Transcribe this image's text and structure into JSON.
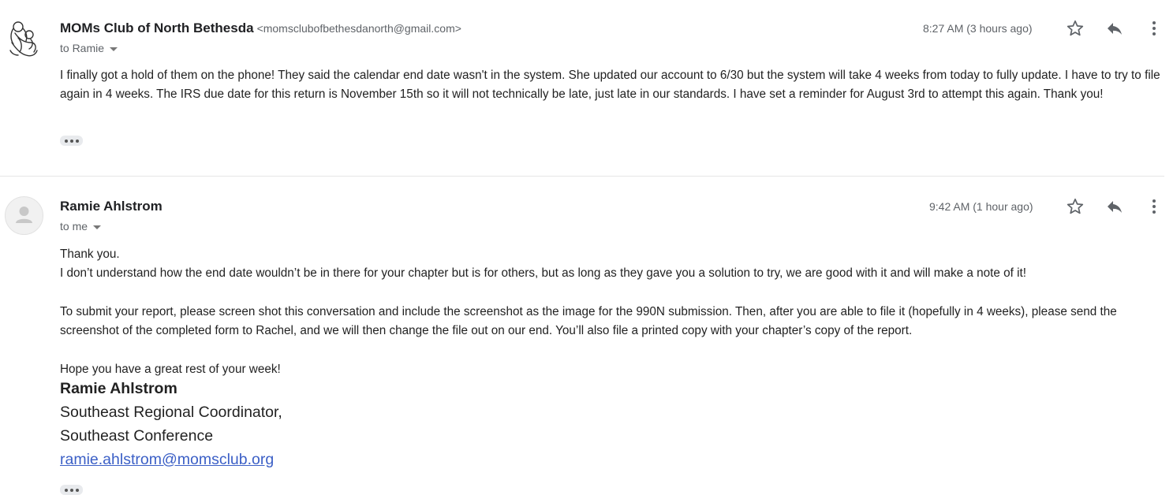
{
  "messages": [
    {
      "sender_name": "MOMs Club of North Bethesda",
      "sender_email": "<momsclubofbethesdanorth@gmail.com>",
      "to": "to Ramie",
      "timestamp": "8:27 AM (3 hours ago)",
      "avatar_icon": "club-logo-icon",
      "body": [
        "I finally got a hold of them on the phone! They said the calendar end date wasn't in the system. She updated our account to 6/30 but the system will take 4 weeks from today to fully update. I have to try to file again in 4 weeks. The IRS due date for this return is November 15th so it will not technically be late, just late in our standards. I have set a reminder for August 3rd to attempt this again. Thank you!"
      ]
    },
    {
      "sender_name": "Ramie Ahlstrom",
      "to": "to me",
      "timestamp": "9:42 AM (1 hour ago)",
      "avatar_icon": "default-person-icon",
      "body": [
        "Thank you.",
        "I don’t understand how the end date wouldn’t be in there for your chapter but is for others, but as long as they gave you a solution to try, we are good with it and will make a note of it!",
        "To submit your report, please screen shot this conversation and include the screenshot as the image for the 990N submission. Then, after you are able to file it (hopefully in 4 weeks), please send the screenshot of the completed form to Rachel, and we will then change the file out on our end. You’ll also file a printed copy with your chapter’s copy of the report.",
        "Hope you have a great rest of your week!"
      ],
      "signature": {
        "name": "Ramie Ahlstrom",
        "title": "Southeast Regional Coordinator,",
        "conference": "Southeast Conference",
        "email": "ramie.ahlstrom@momsclub.org"
      }
    }
  ],
  "icons": {
    "star": "star-icon",
    "reply": "reply-icon",
    "more": "more-vert-icon",
    "expand": "ellipsis-icon",
    "recipients_dropdown": "caret-down-icon"
  },
  "colors": {
    "link": "#3b5fc6",
    "secondary_text": "#5f6368",
    "icon": "#5f6368"
  }
}
